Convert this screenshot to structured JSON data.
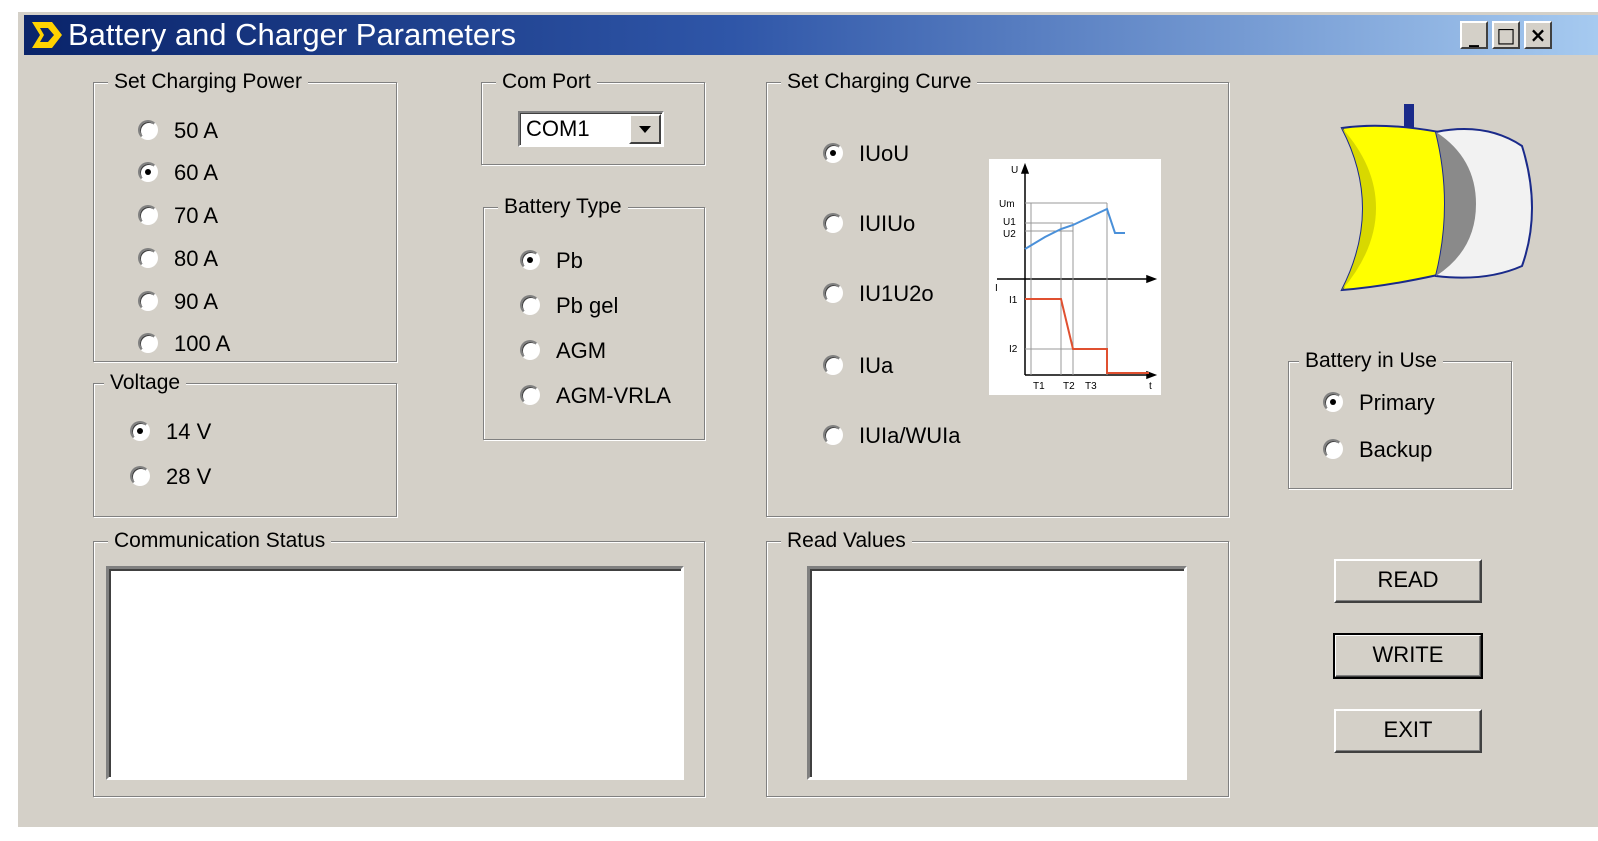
{
  "window": {
    "title": "Battery and Charger Parameters",
    "minimize": "_",
    "maximize": "□",
    "close": "×"
  },
  "charging_power": {
    "title": "Set Charging Power",
    "options": [
      {
        "label": "50 A",
        "checked": false
      },
      {
        "label": "60 A",
        "checked": true
      },
      {
        "label": "70 A",
        "checked": false
      },
      {
        "label": "80 A",
        "checked": false
      },
      {
        "label": "90 A",
        "checked": false
      },
      {
        "label": "100 A",
        "checked": false
      }
    ]
  },
  "voltage": {
    "title": "Voltage",
    "options": [
      {
        "label": "14 V",
        "checked": true
      },
      {
        "label": "28 V",
        "checked": false
      }
    ]
  },
  "com_port": {
    "title": "Com Port",
    "value": "COM1"
  },
  "battery_type": {
    "title": "Battery Type",
    "options": [
      {
        "label": "Pb",
        "checked": true
      },
      {
        "label": "Pb gel",
        "checked": false
      },
      {
        "label": "AGM",
        "checked": false
      },
      {
        "label": "AGM-VRLA",
        "checked": false
      }
    ]
  },
  "charging_curve": {
    "title": "Set Charging Curve",
    "options": [
      {
        "label": "IUoU",
        "checked": true
      },
      {
        "label": "IUIUo",
        "checked": false
      },
      {
        "label": "IU1U2o",
        "checked": false
      },
      {
        "label": "IUa",
        "checked": false
      },
      {
        "label": "IUIa/WUIa",
        "checked": false
      }
    ],
    "diagram_labels": {
      "u": "U",
      "um": "Um",
      "u1": "U1",
      "u2": "U2",
      "i": "I",
      "i1": "I1",
      "i2": "I2",
      "t1": "T1",
      "t2": "T2",
      "t3": "T3",
      "t": "t"
    }
  },
  "battery_in_use": {
    "title": "Battery in Use",
    "options": [
      {
        "label": "Primary",
        "checked": true
      },
      {
        "label": "Backup",
        "checked": false
      }
    ]
  },
  "communication_status": {
    "title": "Communication Status",
    "text": ""
  },
  "read_values": {
    "title": "Read Values",
    "text": ""
  },
  "buttons": {
    "read": "READ",
    "write": "WRITE",
    "exit": "EXIT"
  },
  "colors": {
    "title_start": "#0a246a",
    "title_end": "#a6caf0",
    "face": "#d4d0c8",
    "battery_yellow": "#ffff00",
    "curve_blue": "#4a90d9",
    "curve_red": "#e05030"
  }
}
